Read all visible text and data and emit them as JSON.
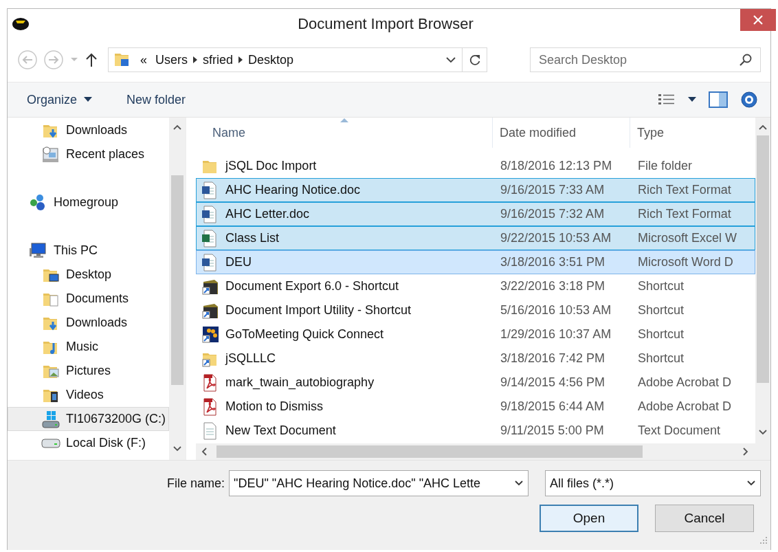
{
  "window": {
    "title": "Document Import Browser"
  },
  "navigation": {
    "overflow": "«",
    "path": [
      "Users",
      "sfried",
      "Desktop"
    ]
  },
  "search": {
    "placeholder": "Search Desktop"
  },
  "toolbar": {
    "buttons": [
      {
        "label": "Organize",
        "dropdown": true
      },
      {
        "label": "New folder",
        "dropdown": false
      }
    ]
  },
  "sidebar": {
    "items": [
      {
        "children": [
          {
            "label": "Downloads",
            "kind": "downloads",
            "selected": false
          },
          {
            "label": "Recent places",
            "kind": "recent",
            "selected": false
          }
        ]
      },
      {
        "label": "Homegroup",
        "kind": "homegroup",
        "selected": false
      },
      {
        "label": "This PC",
        "kind": "pc",
        "selected": false,
        "children": [
          {
            "label": "Desktop",
            "kind": "desktop",
            "selected": false
          },
          {
            "label": "Documents",
            "kind": "documents",
            "selected": false
          },
          {
            "label": "Downloads",
            "kind": "downloads",
            "selected": false
          },
          {
            "label": "Music",
            "kind": "music",
            "selected": false
          },
          {
            "label": "Pictures",
            "kind": "pictures",
            "selected": false
          },
          {
            "label": "Videos",
            "kind": "videos",
            "selected": false
          },
          {
            "label": "TI10673200G (C:)",
            "kind": "system-drive",
            "selected": true
          },
          {
            "label": "Local Disk (F:)",
            "kind": "drive",
            "selected": false
          }
        ]
      }
    ]
  },
  "table": {
    "columns": [
      {
        "label": "Name",
        "sorted": true
      },
      {
        "label": "Date modified",
        "sorted": false
      },
      {
        "label": "Type",
        "sorted": false
      }
    ],
    "rows": [
      {
        "name": "jSQL Doc Import",
        "date_modified": "8/18/2016 12:13 PM",
        "type": "File folder",
        "kind": "folder",
        "selected": false,
        "focused": false
      },
      {
        "name": "AHC Hearing Notice.doc",
        "date_modified": "9/16/2015 7:33 AM",
        "type": "Rich Text Format",
        "kind": "word",
        "selected": true,
        "focused": false
      },
      {
        "name": "AHC Letter.doc",
        "date_modified": "9/16/2015 7:32 AM",
        "type": "Rich Text Format",
        "kind": "word",
        "selected": true,
        "focused": false
      },
      {
        "name": "Class List",
        "date_modified": "9/22/2015 10:53 AM",
        "type": "Microsoft Excel W",
        "kind": "excel",
        "selected": true,
        "focused": false
      },
      {
        "name": "DEU",
        "date_modified": "3/18/2016 3:51 PM",
        "type": "Microsoft Word D",
        "kind": "word",
        "selected": true,
        "focused": true
      },
      {
        "name": "Document Export 6.0 - Shortcut",
        "date_modified": "3/22/2016 3:18 PM",
        "type": "Shortcut",
        "kind": "app-shortcut",
        "selected": false,
        "focused": false
      },
      {
        "name": "Document Import Utility - Shortcut",
        "date_modified": "5/16/2016 10:53 AM",
        "type": "Shortcut",
        "kind": "app-shortcut",
        "selected": false,
        "focused": false
      },
      {
        "name": "GoToMeeting Quick Connect",
        "date_modified": "1/29/2016 10:37 AM",
        "type": "Shortcut",
        "kind": "meeting-shortcut",
        "selected": false,
        "focused": false
      },
      {
        "name": "jSQLLLC",
        "date_modified": "3/18/2016 7:42 PM",
        "type": "Shortcut",
        "kind": "folder-shortcut",
        "selected": false,
        "focused": false
      },
      {
        "name": "mark_twain_autobiography",
        "date_modified": "9/14/2015 4:56 PM",
        "type": "Adobe Acrobat D",
        "kind": "pdf",
        "selected": false,
        "focused": false
      },
      {
        "name": "Motion to Dismiss",
        "date_modified": "9/18/2015 6:44 AM",
        "type": "Adobe Acrobat D",
        "kind": "pdf",
        "selected": false,
        "focused": false
      },
      {
        "name": "New Text Document",
        "date_modified": "9/11/2015 5:00 PM",
        "type": "Text Document",
        "kind": "text",
        "selected": false,
        "focused": false
      }
    ]
  },
  "footer": {
    "file_name": {
      "label": "File name:",
      "value": "\"DEU\" \"AHC Hearing Notice.doc\" \"AHC Lette"
    },
    "filter": {
      "value": "All files (*.*)"
    },
    "buttons": [
      {
        "label": "Open",
        "default": true
      },
      {
        "label": "Cancel",
        "default": false
      }
    ]
  }
}
